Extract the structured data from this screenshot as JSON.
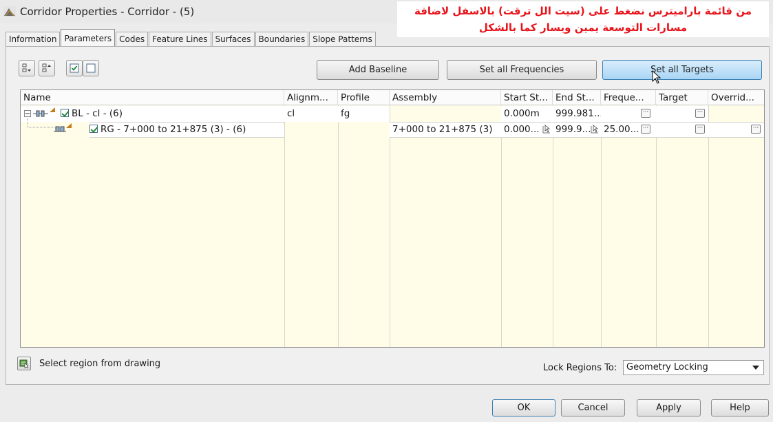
{
  "window": {
    "title": "Corridor Properties - Corridor - (5)"
  },
  "annotation": {
    "line1": "من قائمة باراميترس نضغط على (سيت الل ترقت) بالاسفل لاضافة",
    "line2": "مسارات التوسعة يمين ويسار كما بالشكل"
  },
  "tabs": [
    {
      "label": "Information",
      "active": false
    },
    {
      "label": "Parameters",
      "active": true
    },
    {
      "label": "Codes",
      "active": false
    },
    {
      "label": "Feature Lines",
      "active": false
    },
    {
      "label": "Surfaces",
      "active": false
    },
    {
      "label": "Boundaries",
      "active": false
    },
    {
      "label": "Slope Patterns",
      "active": false
    }
  ],
  "toolbar": {
    "add_baseline": "Add Baseline",
    "set_all_frequencies": "Set all Frequencies",
    "set_all_targets": "Set all Targets"
  },
  "grid": {
    "columns": [
      "Name",
      "Alignm...",
      "Profile",
      "Assembly",
      "Start St...",
      "End St...",
      "Freque...",
      "Target",
      "Overrid..."
    ],
    "rows": [
      {
        "name": "BL - cl - (6)",
        "alignment": "cl",
        "profile": "fg",
        "assembly": "",
        "start": "0.000m",
        "end": "999.981...",
        "frequency": "",
        "checked": true
      },
      {
        "name": "RG - 7+000 to 21+875 (3) - (6)",
        "alignment": "",
        "profile": "",
        "assembly": "7+000 to 21+875 (3)",
        "start": "0.000...",
        "end": "999.9...",
        "frequency": "25.00...",
        "checked": true
      }
    ]
  },
  "footer": {
    "select_region": "Select region from drawing",
    "lock_label": "Lock Regions To:",
    "lock_value": "Geometry Locking"
  },
  "dialog_buttons": {
    "ok": "OK",
    "cancel": "Cancel",
    "apply": "Apply",
    "help": "Help"
  },
  "colors": {
    "grid_background": "#fffde8",
    "annotation_text": "#e8141b",
    "hot_button": "#a9d5f5"
  }
}
